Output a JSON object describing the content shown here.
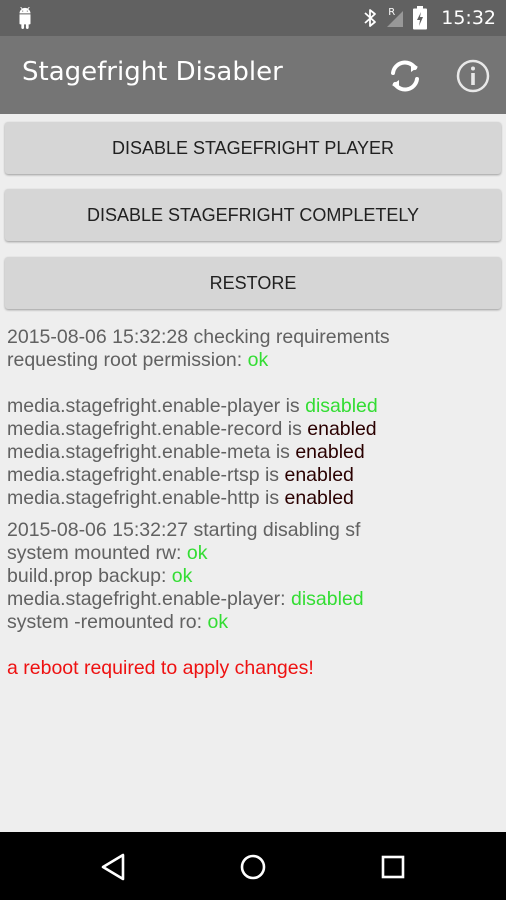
{
  "status_bar": {
    "time": "15:32",
    "roaming_label": "R",
    "icons": [
      "android-debug-icon",
      "bluetooth-icon",
      "signal-icon",
      "battery-icon"
    ]
  },
  "app_bar": {
    "title": "Stagefright Disabler",
    "actions": [
      "refresh-icon",
      "info-icon"
    ]
  },
  "buttons": {
    "disable_player": "DISABLE STAGEFRIGHT PLAYER",
    "disable_completely": "DISABLE STAGEFRIGHT COMPLETELY",
    "restore": "RESTORE"
  },
  "log": {
    "block1": {
      "line1": "2015-08-06 15:32:28 checking requirements",
      "line2_label": "requesting root permission: ",
      "line2_value": "ok"
    },
    "props": [
      {
        "label": "media.stagefright.enable-player is ",
        "value": "disabled"
      },
      {
        "label": "media.stagefright.enable-record is ",
        "value": "enabled"
      },
      {
        "label": "media.stagefright.enable-meta is ",
        "value": "enabled"
      },
      {
        "label": "media.stagefright.enable-rtsp is ",
        "value": "enabled"
      },
      {
        "label": "media.stagefright.enable-http is ",
        "value": "enabled"
      }
    ],
    "block2": {
      "line1": "2015-08-06 15:32:27 starting disabling sf",
      "steps": [
        {
          "label": "system mounted rw: ",
          "value": "ok"
        },
        {
          "label": "build.prop backup: ",
          "value": "ok"
        },
        {
          "label": "media.stagefright.enable-player: ",
          "value": "disabled"
        },
        {
          "label": "system -remounted ro: ",
          "value": "ok"
        }
      ]
    },
    "reboot_message": "a reboot required to apply changes!"
  },
  "colors": {
    "status_bar": "#616161",
    "app_bar": "#757575",
    "background": "#eeeeee",
    "button": "#d6d6d6",
    "ok_green": "#33dd33",
    "enabled_dark": "#2a0000",
    "warning_red": "#ee1111"
  },
  "nav_bar": {
    "icons": [
      "back-icon",
      "home-icon",
      "recents-icon"
    ]
  }
}
